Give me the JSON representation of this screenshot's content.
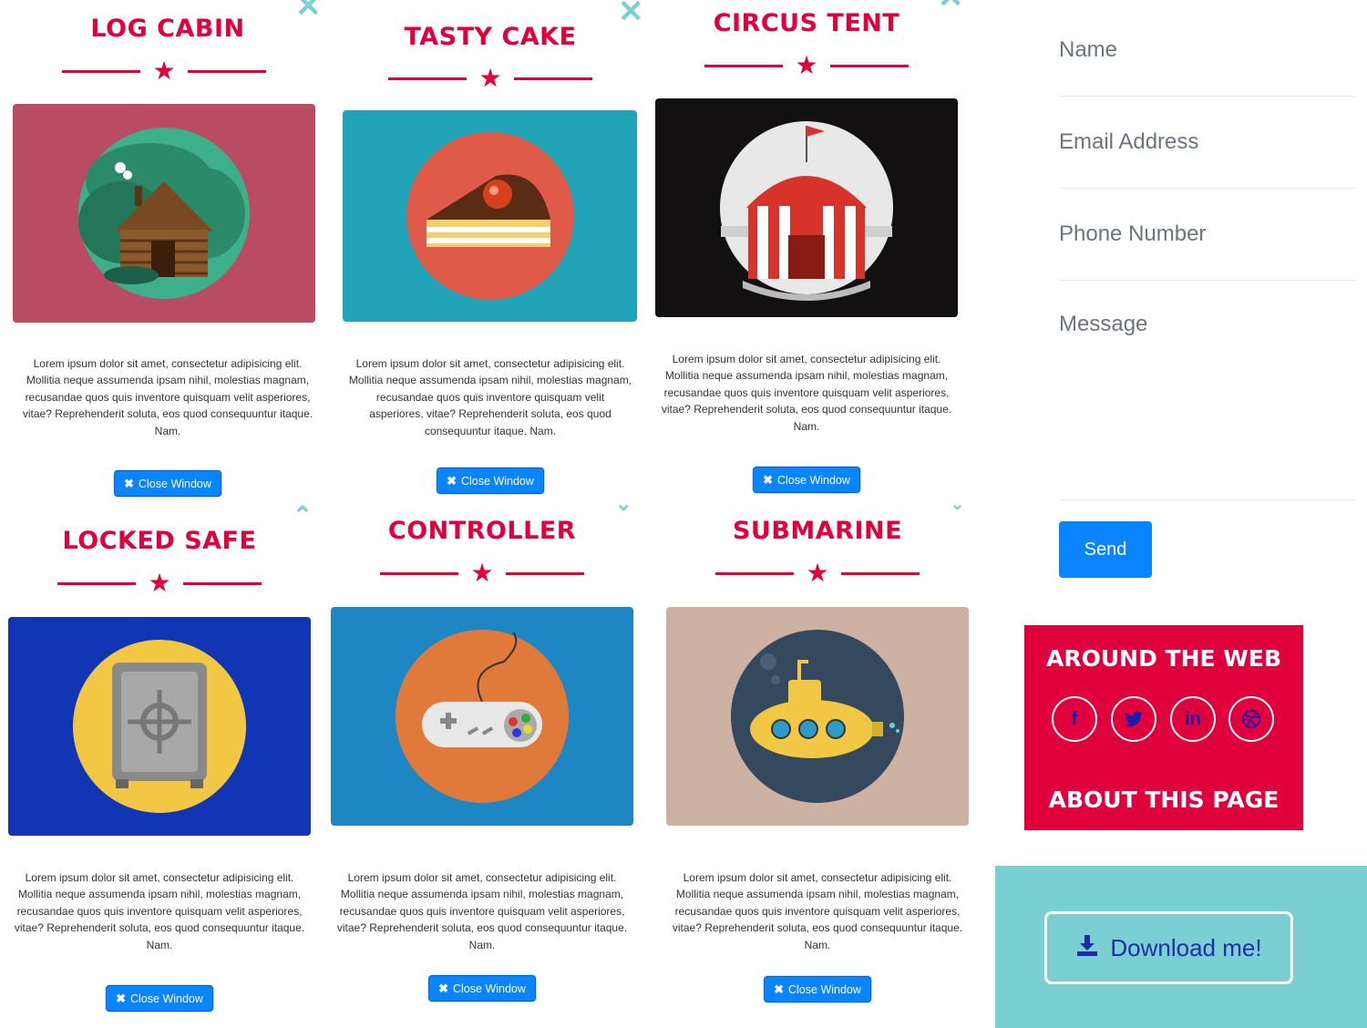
{
  "modals": [
    {
      "id": "log-cabin",
      "title": "LOG CABIN",
      "description": "Lorem ipsum dolor sit amet, consectetur adipisicing elit. Mollitia neque assumenda ipsam nihil, molestias magnam, recusandae quos quis inventore quisquam velit asperiores, vitae? Reprehenderit soluta, eos quod consequuntur itaque. Nam.",
      "close_label": "Close Window",
      "bg_color": "#b94b63",
      "icon": "log-cabin-icon"
    },
    {
      "id": "tasty-cake",
      "title": "TASTY CAKE",
      "description": "Lorem ipsum dolor sit amet, consectetur adipisicing elit. Mollitia neque assumenda ipsam nihil, molestias magnam, recusandae quos quis inventore quisquam velit asperiores, vitae? Reprehenderit soluta, eos quod consequuntur itaque. Nam.",
      "close_label": "Close Window",
      "bg_color": "#21a3b8",
      "icon": "cake-icon"
    },
    {
      "id": "circus-tent",
      "title": "CIRCUS TENT",
      "description": "Lorem ipsum dolor sit amet, consectetur adipisicing elit. Mollitia neque assumenda ipsam nihil, molestias magnam, recusandae quos quis inventore quisquam velit asperiores, vitae? Reprehenderit soluta, eos quod consequuntur itaque. Nam.",
      "close_label": "Close Window",
      "bg_color": "#121010",
      "icon": "circus-tent-icon"
    },
    {
      "id": "locked-safe",
      "title": "LOCKED SAFE",
      "description": "Lorem ipsum dolor sit amet, consectetur adipisicing elit. Mollitia neque assumenda ipsam nihil, molestias magnam, recusandae quos quis inventore quisquam velit asperiores, vitae? Reprehenderit soluta, eos quod consequuntur itaque. Nam.",
      "close_label": "Close Window",
      "bg_color": "#1235b5",
      "icon": "safe-icon"
    },
    {
      "id": "controller",
      "title": "CONTROLLER",
      "description": "Lorem ipsum dolor sit amet, consectetur adipisicing elit. Mollitia neque assumenda ipsam nihil, molestias magnam, recusandae quos quis inventore quisquam velit asperiores, vitae? Reprehenderit soluta, eos quod consequuntur itaque. Nam.",
      "close_label": "Close Window",
      "bg_color": "#1e87c3",
      "icon": "game-controller-icon"
    },
    {
      "id": "submarine",
      "title": "SUBMARINE",
      "description": "Lorem ipsum dolor sit amet, consectetur adipisicing elit. Mollitia neque assumenda ipsam nihil, molestias magnam, recusandae quos quis inventore quisquam velit asperiores, vitae? Reprehenderit soluta, eos quod consequuntur itaque. Nam.",
      "close_label": "Close Window",
      "bg_color": "#cdb2a3",
      "icon": "submarine-icon"
    }
  ],
  "contact_form": {
    "name_placeholder": "Name",
    "email_placeholder": "Email Address",
    "phone_placeholder": "Phone Number",
    "message_placeholder": "Message",
    "send_label": "Send"
  },
  "footer": {
    "around_heading": "AROUND THE WEB",
    "about_heading": "ABOUT THIS PAGE",
    "social": [
      {
        "icon": "facebook-icon",
        "glyph": "f"
      },
      {
        "icon": "twitter-icon",
        "glyph": "🐦"
      },
      {
        "icon": "linkedin-icon",
        "glyph": "in"
      },
      {
        "icon": "dribbble-icon",
        "glyph": "⊛"
      }
    ],
    "accent_color": "#e0003c"
  },
  "download": {
    "label": "Download me!",
    "bg_color": "#79cfd1"
  },
  "colors": {
    "accent": "#e0003c",
    "button": "#0a84ff"
  }
}
